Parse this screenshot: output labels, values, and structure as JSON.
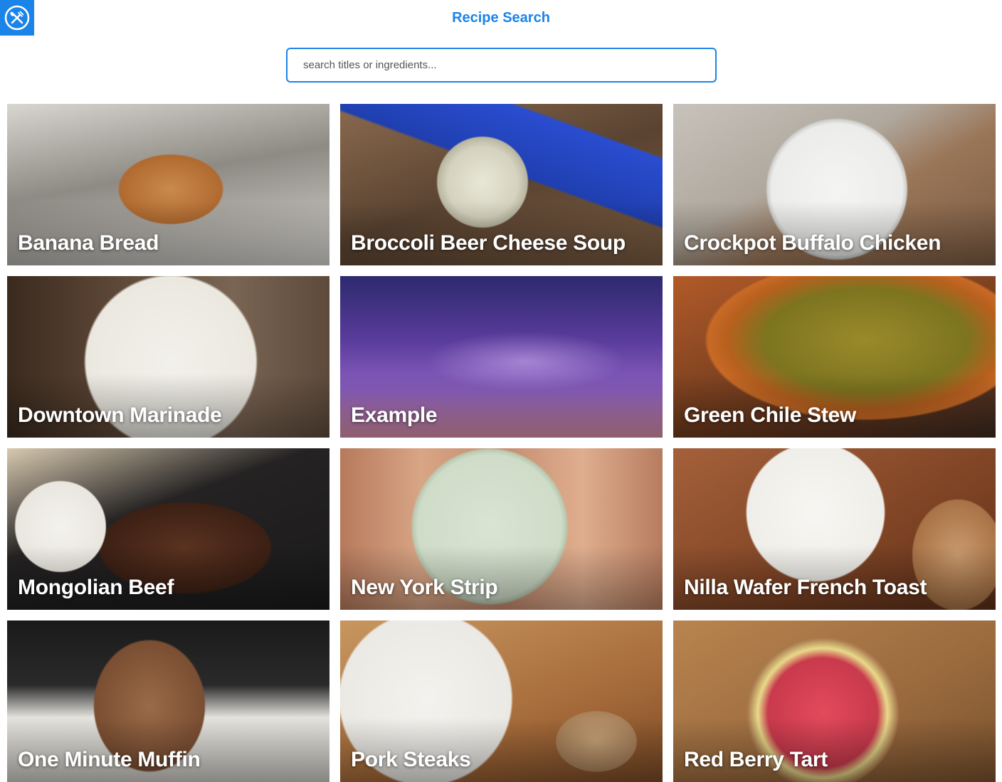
{
  "app": {
    "title": "Recipe Search",
    "logo_icon": "fork-knife-icon",
    "brand_color": "#1a84e8"
  },
  "search": {
    "placeholder": "search titles or ingredients...",
    "value": ""
  },
  "recipes": [
    {
      "title": "Banana Bread"
    },
    {
      "title": "Broccoli Beer Cheese Soup"
    },
    {
      "title": "Crockpot Buffalo Chicken"
    },
    {
      "title": "Downtown Marinade"
    },
    {
      "title": "Example"
    },
    {
      "title": "Green Chile Stew"
    },
    {
      "title": "Mongolian Beef"
    },
    {
      "title": "New York Strip"
    },
    {
      "title": "Nilla Wafer French Toast"
    },
    {
      "title": "One Minute Muffin"
    },
    {
      "title": "Pork Steaks"
    },
    {
      "title": "Red Berry Tart"
    }
  ]
}
